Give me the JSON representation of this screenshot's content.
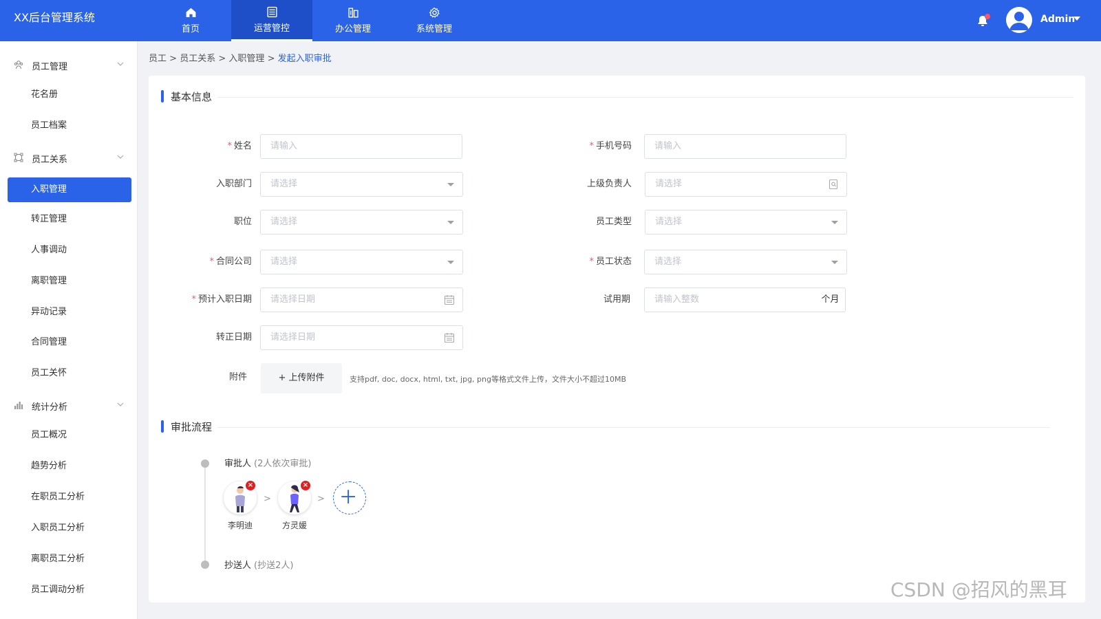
{
  "app": {
    "title": "XX后台管理系统"
  },
  "topnav": [
    {
      "label": "首页",
      "icon": "home-icon"
    },
    {
      "label": "运营管控",
      "icon": "server-icon",
      "active": true
    },
    {
      "label": "办公管理",
      "icon": "building-icon"
    },
    {
      "label": "系统管理",
      "icon": "gear-icon"
    }
  ],
  "user": {
    "name": "Admin"
  },
  "sidebar": {
    "groups": [
      {
        "label": "员工管理",
        "icon": "people-icon"
      },
      {
        "label": "员工关系",
        "icon": "relation-icon"
      },
      {
        "label": "统计分析",
        "icon": "bar-chart-icon"
      }
    ],
    "items": [
      {
        "label": "花名册"
      },
      {
        "label": "员工档案"
      },
      {
        "label": "入职管理",
        "active": true
      },
      {
        "label": "转正管理"
      },
      {
        "label": "人事调动"
      },
      {
        "label": "离职管理"
      },
      {
        "label": "异动记录"
      },
      {
        "label": "合同管理"
      },
      {
        "label": "员工关怀"
      },
      {
        "label": "员工概况"
      },
      {
        "label": "趋势分析"
      },
      {
        "label": "在职员工分析"
      },
      {
        "label": "入职员工分析"
      },
      {
        "label": "离职员工分析"
      },
      {
        "label": "员工调动分析"
      }
    ]
  },
  "breadcrumb": {
    "part1": "员工",
    "part2": "员工关系",
    "part3": "入职管理",
    "current": "发起入职审批",
    "sep": ">"
  },
  "section1": {
    "title": "基本信息"
  },
  "form": {
    "name": {
      "label": "姓名",
      "placeholder": "请输入"
    },
    "phone": {
      "label": "手机号码",
      "placeholder": "请输入"
    },
    "dept": {
      "label": "入职部门",
      "placeholder": "请选择"
    },
    "manager": {
      "label": "上级负责人",
      "placeholder": "请选择"
    },
    "position": {
      "label": "职位",
      "placeholder": "请选择"
    },
    "emp_type": {
      "label": "员工类型",
      "placeholder": "请选择"
    },
    "company": {
      "label": "合同公司",
      "placeholder": "请选择"
    },
    "emp_status": {
      "label": "员工状态",
      "placeholder": "请选择"
    },
    "entry_date": {
      "label": "预计入职日期",
      "placeholder": "请选择日期"
    },
    "probation": {
      "label": "试用期",
      "placeholder": "请输入整数",
      "suffix": "个月"
    },
    "regular_date": {
      "label": "转正日期",
      "placeholder": "请选择日期"
    },
    "attachment": {
      "label": "附件",
      "button": "+ 上传附件",
      "hint": "支持pdf, doc, docx, html, txt, jpg, png等格式文件上传，文件大小不超过10MB"
    },
    "required_mark": "*"
  },
  "section2": {
    "title": "审批流程"
  },
  "approval": {
    "approver_title": "审批人",
    "approver_note": "(2人依次审批)",
    "approvers": [
      {
        "name": "李明迪"
      },
      {
        "name": "方灵媛"
      }
    ],
    "separator": ">",
    "delete_mark": "×",
    "cc_title": "抄送人",
    "cc_note": "(抄送2人)"
  },
  "watermark": "CSDN @招风的黑耳",
  "colors": {
    "primary": "#2a63e8",
    "danger": "#e02020",
    "notify_dot": "#f5576c"
  }
}
